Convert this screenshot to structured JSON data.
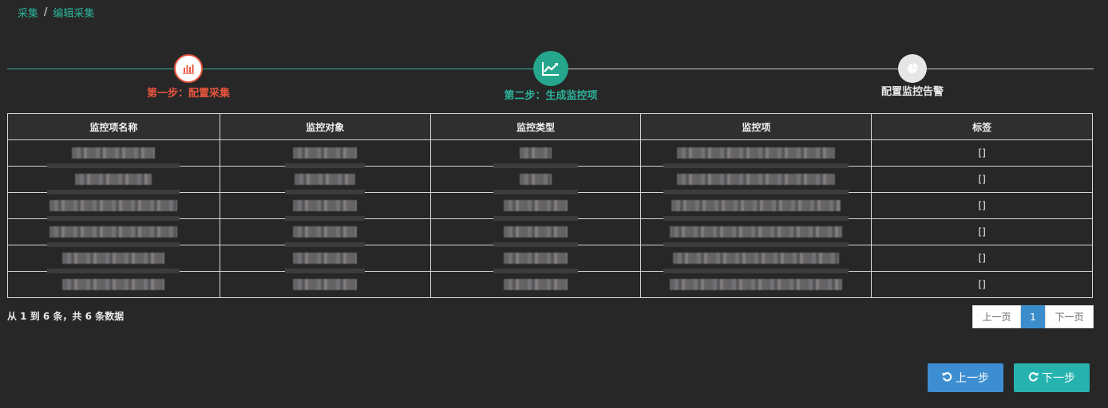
{
  "breadcrumb": {
    "root": "采集",
    "separator": "/",
    "current": "编辑采集"
  },
  "steps": [
    {
      "label": "第一步：配置采集",
      "icon": "bar-chart-icon",
      "status": "completed",
      "color": "#e8553f"
    },
    {
      "label": "第二步：生成监控项",
      "icon": "line-chart-icon",
      "status": "active",
      "color": "#2bb39a"
    },
    {
      "label": "配置监控告警",
      "icon": "pie-chart-icon",
      "status": "pending",
      "color": "#e6e6e6"
    }
  ],
  "table": {
    "headers": [
      "监控项名称",
      "监控对象",
      "监控类型",
      "监控项",
      "标签"
    ],
    "rows": [
      {
        "tag": "[]"
      },
      {
        "tag": "[]"
      },
      {
        "tag": "[]"
      },
      {
        "tag": "[]"
      },
      {
        "tag": "[]"
      },
      {
        "tag": "[]"
      }
    ]
  },
  "summary": "从 1 到 6 条，共 6 条数据",
  "pagination": {
    "prev": "上一页",
    "current": "1",
    "next": "下一页"
  },
  "actions": {
    "prev": "上一步",
    "next": "下一步"
  },
  "colors": {
    "background": "#272727",
    "accent": "#2bb39a",
    "step1": "#e8553f",
    "pageActive": "#3c8dcc",
    "btnPrev": "#3d8ed0",
    "btnNext": "#26b3b0"
  }
}
